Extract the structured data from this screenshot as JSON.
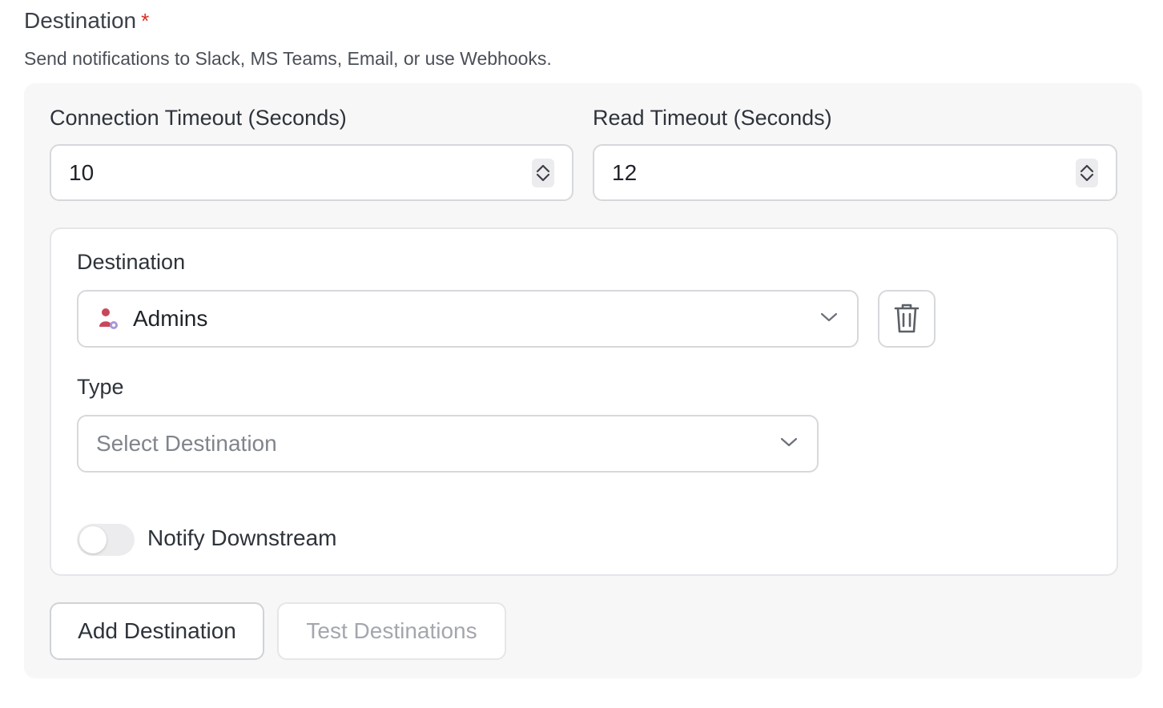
{
  "header": {
    "title": "Destination",
    "required_mark": "*",
    "description": "Send notifications to Slack, MS Teams, Email, or use Webhooks."
  },
  "timeouts": {
    "connection": {
      "label": "Connection Timeout (Seconds)",
      "value": "10"
    },
    "read": {
      "label": "Read Timeout (Seconds)",
      "value": "12"
    }
  },
  "destination_card": {
    "destination_label": "Destination",
    "destination_value": "Admins",
    "destination_icon": "admin-user-icon",
    "type_label": "Type",
    "type_placeholder": "Select Destination",
    "notify_downstream_label": "Notify Downstream",
    "notify_downstream_enabled": false
  },
  "actions": {
    "add_label": "Add Destination",
    "test_label": "Test Destinations"
  },
  "colors": {
    "required": "#d92d20",
    "border": "#d6d8dc",
    "panel_bg": "#f7f7f8",
    "disabled_text": "#a3a7ad"
  }
}
